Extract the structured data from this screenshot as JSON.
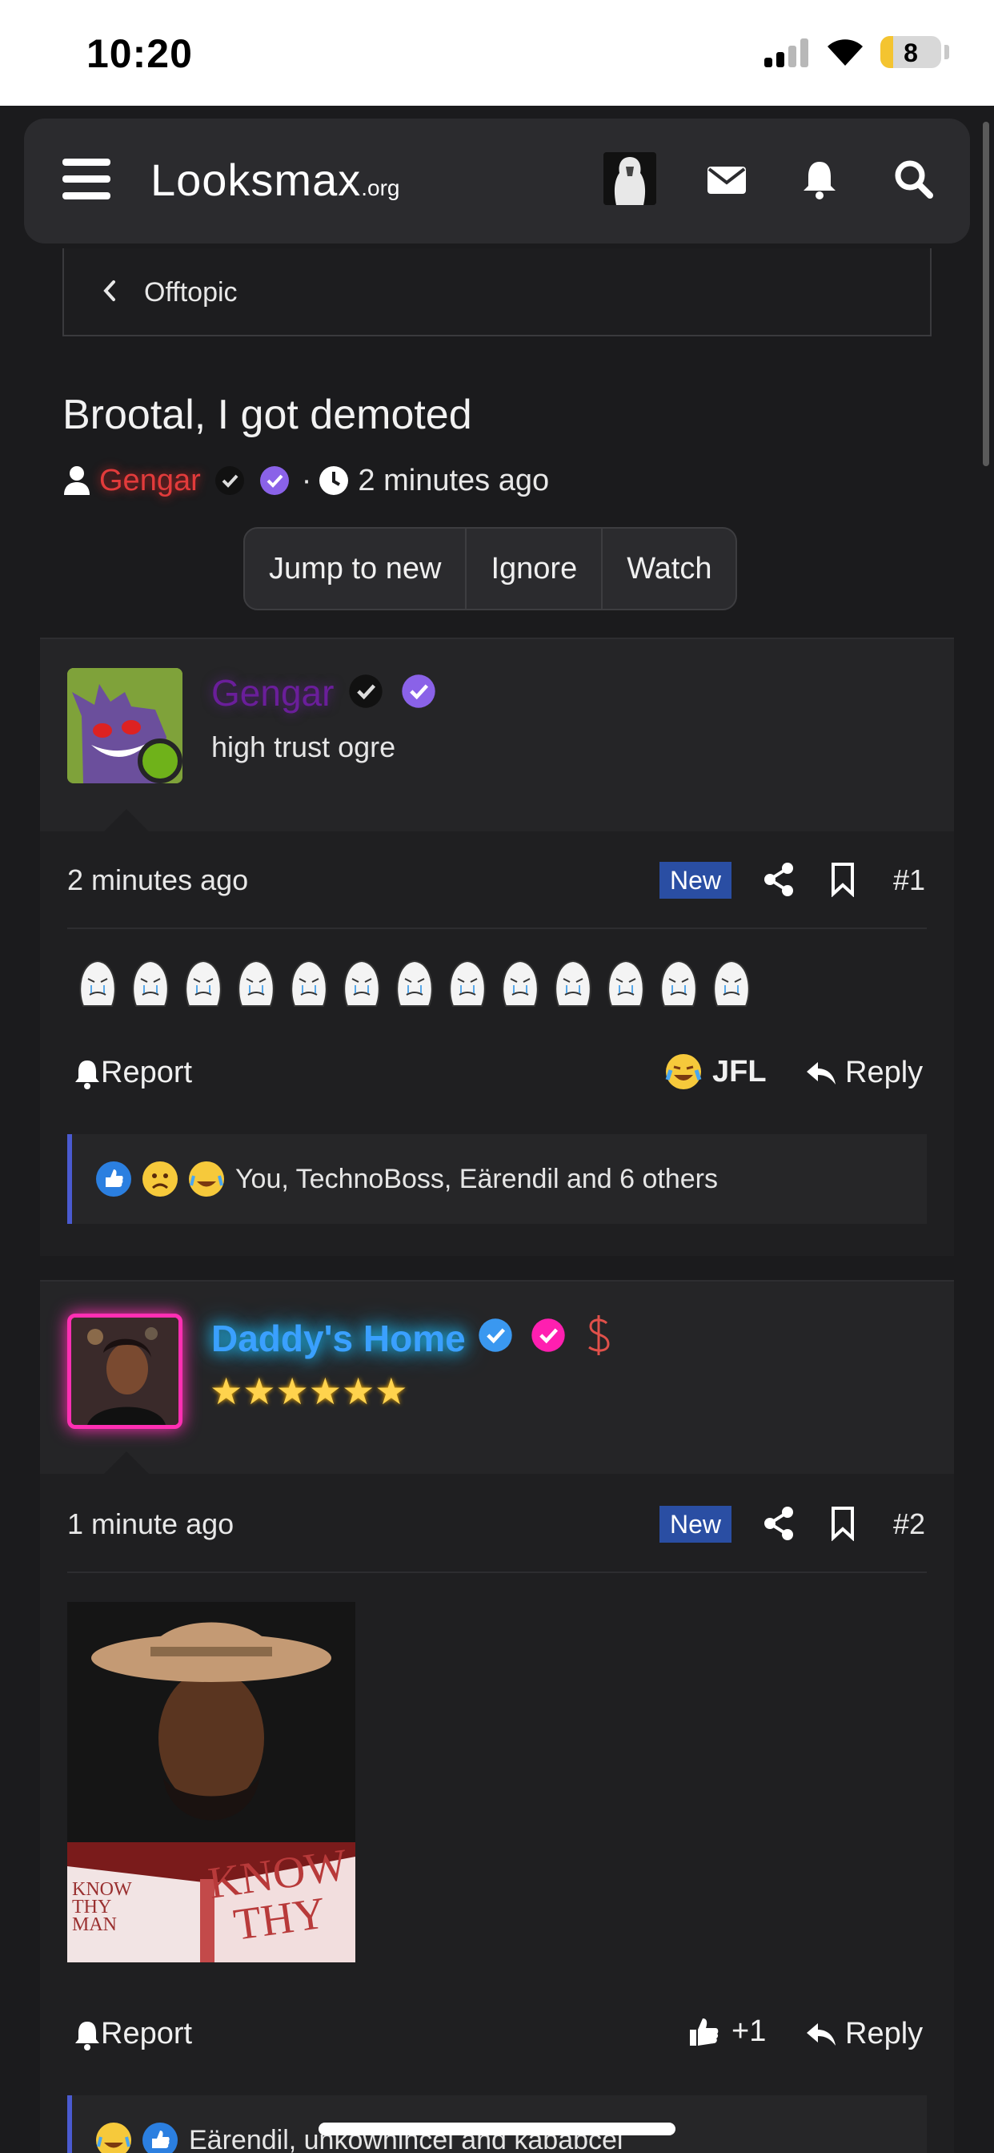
{
  "status_bar": {
    "time": "10:20",
    "battery": "8"
  },
  "header": {
    "logo_main": "Looksmax",
    "logo_suffix": ".org"
  },
  "breadcrumb": {
    "label": "Offtopic"
  },
  "thread": {
    "title": "Brootal, I got demoted",
    "author": "Gengar",
    "separator": "·",
    "time": "2 minutes ago",
    "buttons": [
      "Jump to new",
      "Ignore",
      "Watch"
    ]
  },
  "posts": [
    {
      "username": "Gengar",
      "user_title": "high trust ogre",
      "time": "2 minutes ago",
      "new_label": "New",
      "number": "#1",
      "report_label": "Report",
      "reaction_label": "JFL",
      "reply_label": "Reply",
      "reactions_text": "You, TechnoBoss, Eärendil and 6 others",
      "colors": {
        "username": "#6a1e9a"
      }
    },
    {
      "username": "Daddy's Home",
      "stars": "★★★★★★",
      "time": "1 minute ago",
      "new_label": "New",
      "number": "#2",
      "report_label": "Report",
      "reaction_label": "+1",
      "reply_label": "Reply",
      "reactions_text": "Eärendil, unkownincel and kababcel",
      "image_text": {
        "line1": "KNOW",
        "line2": "THY",
        "spine": "KNOW THY MAN"
      },
      "colors": {
        "username": "#3aa0ff"
      }
    }
  ],
  "colors": {
    "accent": "#2a4ea3",
    "online": "#6fb21a",
    "author": "#e23b3b",
    "pink": "#ff2fb3"
  }
}
